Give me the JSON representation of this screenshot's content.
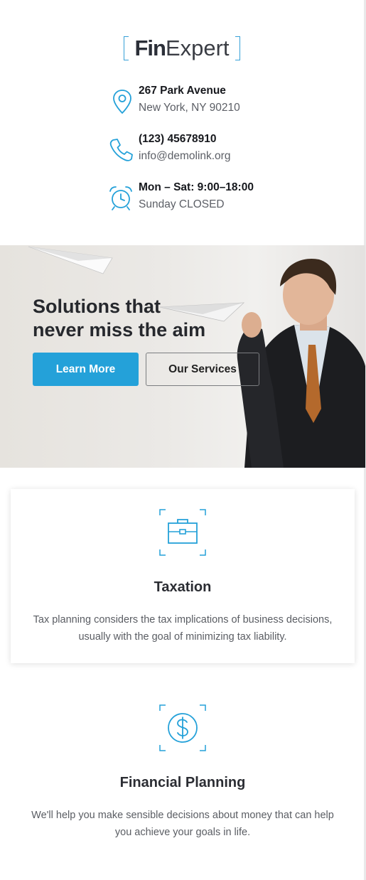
{
  "brand": {
    "fin": "Fin",
    "expert": "Expert"
  },
  "contacts": {
    "address": {
      "line1": "267 Park Avenue",
      "line2": "New York, NY 90210",
      "icon": "map-pin-icon"
    },
    "phone": {
      "line1": "(123) 45678910",
      "line2": "info@demolink.org",
      "icon": "phone-icon"
    },
    "hours": {
      "line1": "Mon – Sat: 9:00–18:00",
      "line2": "Sunday CLOSED",
      "icon": "alarm-clock-icon"
    }
  },
  "hero": {
    "title_line1": "Solutions that",
    "title_line2": "never miss the aim",
    "primary_button": "Learn More",
    "secondary_button": "Our Services"
  },
  "services": [
    {
      "title": "Taxation",
      "text_line1": "Tax planning considers the tax implications of business decisions,",
      "text_line2": "usually with the goal of minimizing tax liability.",
      "icon": "briefcase-icon"
    },
    {
      "title": "Financial Planning",
      "text_line1": "We'll help you make sensible decisions about money that can help",
      "text_line2": "you achieve your goals in life.",
      "icon": "dollar-coin-icon"
    }
  ],
  "colors": {
    "accent": "#24a1d9",
    "text": "#2b2d33",
    "muted": "#5a5d63"
  }
}
